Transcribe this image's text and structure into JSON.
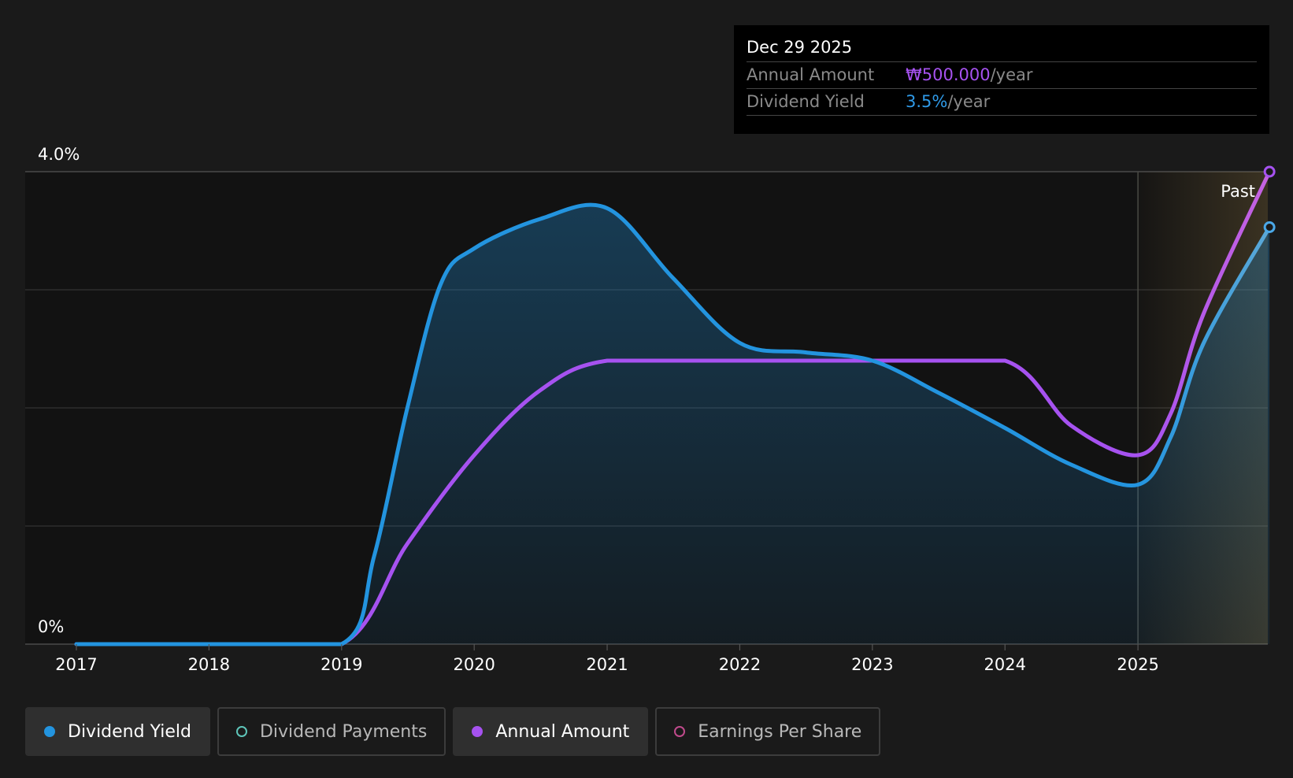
{
  "tooltip": {
    "date": "Dec 29 2025",
    "annual_label": "Annual Amount",
    "annual_value": "₩500.000",
    "annual_unit": "/year",
    "yield_label": "Dividend Yield",
    "yield_value": "3.5%",
    "yield_unit": "/year"
  },
  "past_label": "Past",
  "legend": [
    {
      "label": "Dividend Yield",
      "color": "#2394df",
      "active": true,
      "hollow": false
    },
    {
      "label": "Dividend Payments",
      "color": "#5ec5b9",
      "active": false,
      "hollow": true
    },
    {
      "label": "Annual Amount",
      "color": "#a652f0",
      "active": true,
      "hollow": false
    },
    {
      "label": "Earnings Per Share",
      "color": "#c04a8c",
      "active": false,
      "hollow": true
    }
  ],
  "colors": {
    "yield": "#2394df",
    "annual": "#a652f0",
    "annual_tip": "#c562e0",
    "yield_tip": "#5aa8d8",
    "past_shade": "#c9a45a",
    "background": "#1a1a1a",
    "plot_background": "#121212"
  },
  "chart_data": {
    "type": "line",
    "x_ticks": [
      "2017",
      "2018",
      "2019",
      "2020",
      "2021",
      "2022",
      "2023",
      "2024",
      "2025"
    ],
    "y_tick_labels": [
      "0%",
      "4.0%"
    ],
    "ylim": [
      0,
      4.0
    ],
    "xlim": [
      "2017-01-01",
      "2025-12-29"
    ],
    "past_region_start": "2025-01-01",
    "grid": true,
    "legend_position": "bottom",
    "series": [
      {
        "name": "Dividend Yield",
        "unit": "%",
        "points": [
          [
            "2017-01-01",
            0.0
          ],
          [
            "2018-01-01",
            0.0
          ],
          [
            "2019-01-01",
            0.0
          ],
          [
            "2019-04-01",
            0.75
          ],
          [
            "2019-07-01",
            2.0
          ],
          [
            "2019-10-01",
            3.05
          ],
          [
            "2020-01-01",
            3.35
          ],
          [
            "2020-07-01",
            3.6
          ],
          [
            "2021-01-01",
            3.69
          ],
          [
            "2021-07-01",
            3.1
          ],
          [
            "2022-01-01",
            2.55
          ],
          [
            "2022-07-01",
            2.47
          ],
          [
            "2023-01-01",
            2.4
          ],
          [
            "2023-07-01",
            2.13
          ],
          [
            "2024-01-01",
            1.83
          ],
          [
            "2024-07-01",
            1.52
          ],
          [
            "2025-01-01",
            1.35
          ],
          [
            "2025-04-01",
            1.75
          ],
          [
            "2025-07-01",
            2.55
          ],
          [
            "2025-12-29",
            3.53
          ]
        ]
      },
      {
        "name": "Annual Amount",
        "unit": "₩",
        "points": [
          [
            "2017-01-01",
            0.0
          ],
          [
            "2018-01-01",
            0.0
          ],
          [
            "2019-01-01",
            0.0
          ],
          [
            "2019-07-01",
            0.85
          ],
          [
            "2020-01-01",
            1.6
          ],
          [
            "2020-07-01",
            2.15
          ],
          [
            "2021-01-01",
            2.4
          ],
          [
            "2022-01-01",
            2.4
          ],
          [
            "2023-01-01",
            2.4
          ],
          [
            "2024-01-01",
            2.4
          ],
          [
            "2024-07-01",
            1.85
          ],
          [
            "2025-01-01",
            1.6
          ],
          [
            "2025-04-01",
            1.95
          ],
          [
            "2025-07-01",
            2.8
          ],
          [
            "2025-12-29",
            4.0
          ]
        ]
      }
    ]
  }
}
